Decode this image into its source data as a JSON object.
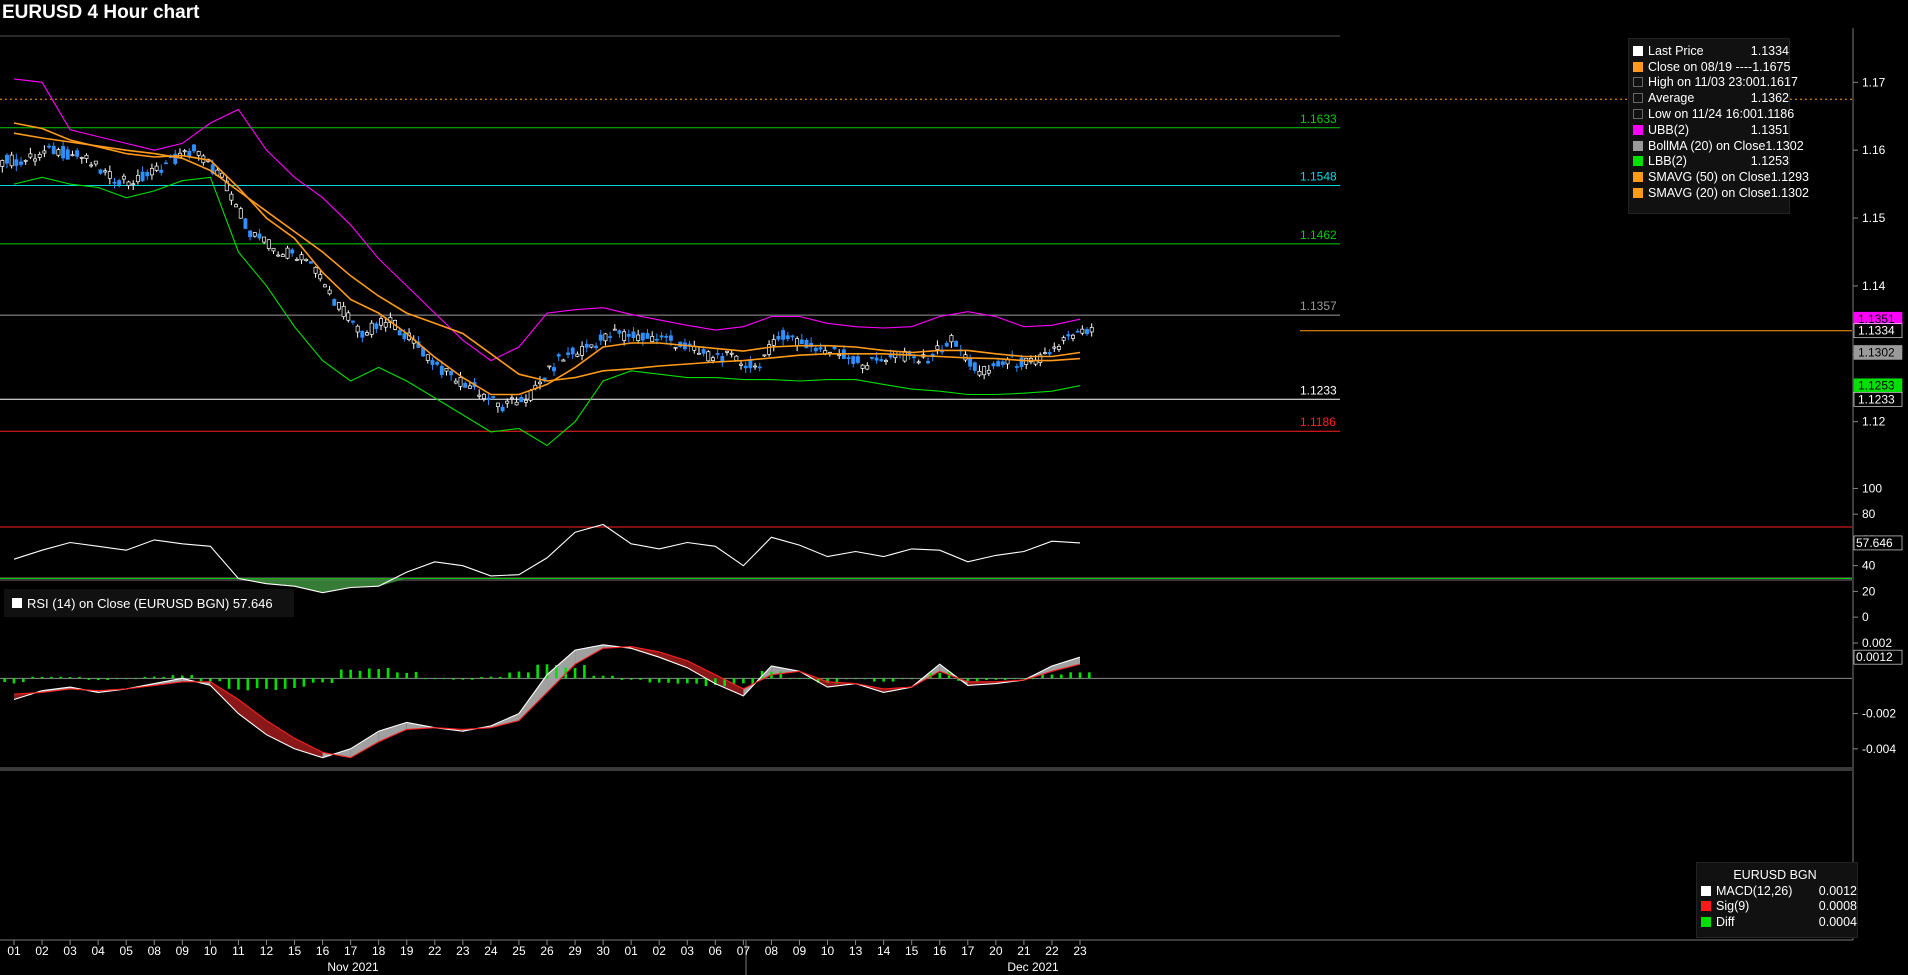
{
  "title": "EURUSD 4 Hour chart",
  "legend": [
    {
      "name": "Last Price",
      "value": "1.1334",
      "color": "#ffffff"
    },
    {
      "name": "Close on 08/19 ----",
      "value": "1.1675",
      "color": "#ff9a1a"
    },
    {
      "name": "High on 11/03 23:00",
      "value": "1.1617",
      "color": ""
    },
    {
      "name": "Average",
      "value": "1.1362",
      "color": ""
    },
    {
      "name": "Low on 11/24 16:00",
      "value": "1.1186",
      "color": ""
    },
    {
      "name": "UBB(2)",
      "value": "1.1351",
      "color": "#ff00ff"
    },
    {
      "name": "BollMA (20)  on Close",
      "value": "1.1302",
      "color": "#9a9a9a"
    },
    {
      "name": "LBB(2)",
      "value": "1.1253",
      "color": "#00e000"
    },
    {
      "name": "SMAVG (50)  on Close",
      "value": "1.1293",
      "color": "#ff9a1a"
    },
    {
      "name": "SMAVG (20)  on Close",
      "value": "1.1302",
      "color": "#ff9a1a"
    }
  ],
  "rsi_legend": "RSI (14)  on Close (EURUSD BGN) 57.646",
  "macd_legend": {
    "title": "EURUSD BGN",
    "rows": [
      {
        "name": "MACD(12,26)",
        "value": "0.0012",
        "color": "#ffffff"
      },
      {
        "name": "Sig(9)",
        "value": "0.0008",
        "color": "#ff1a1a"
      },
      {
        "name": "Diff",
        "value": "0.0004",
        "color": "#00e000"
      }
    ]
  },
  "chart_data": [
    {
      "type": "candlestick",
      "title": "EURUSD 4 Hour chart",
      "ylim": [
        1.112,
        1.178
      ],
      "y_ticks": [
        1.12,
        1.13,
        1.14,
        1.15,
        1.16,
        1.17
      ],
      "x_ticks": [
        "01",
        "02",
        "03",
        "04",
        "05",
        "08",
        "09",
        "10",
        "11",
        "12",
        "15",
        "16",
        "17",
        "18",
        "19",
        "22",
        "23",
        "24",
        "25",
        "26",
        "29",
        "30",
        "01",
        "02",
        "03",
        "06",
        "07",
        "08",
        "09",
        "10",
        "13",
        "14",
        "15",
        "16",
        "17",
        "20",
        "21",
        "22",
        "23"
      ],
      "x_groups": [
        {
          "label": "Nov 2021",
          "start": 0
        },
        {
          "label": "Dec 2021",
          "start": 22
        }
      ],
      "levels": [
        {
          "value": 1.1675,
          "label": "",
          "color": "#ff9a1a",
          "dotted": true
        },
        {
          "value": 1.1633,
          "label": "1.1633",
          "color": "#00cc00"
        },
        {
          "value": 1.1548,
          "label": "1.1548",
          "color": "#00d8e0"
        },
        {
          "value": 1.1462,
          "label": "1.1462",
          "color": "#00cc00"
        },
        {
          "value": 1.1357,
          "label": "1.1357",
          "color": "#9a9a9a"
        },
        {
          "value": 1.1233,
          "label": "1.1233",
          "color": "#ffffff"
        },
        {
          "value": 1.1186,
          "label": "1.1186",
          "color": "#ff2020"
        }
      ],
      "close_by_day": [
        1.1585,
        1.16,
        1.159,
        1.156,
        1.1555,
        1.158,
        1.16,
        1.156,
        1.148,
        1.145,
        1.1445,
        1.138,
        1.133,
        1.135,
        1.131,
        1.127,
        1.125,
        1.122,
        1.124,
        1.129,
        1.131,
        1.133,
        1.1325,
        1.132,
        1.13,
        1.1295,
        1.128,
        1.133,
        1.131,
        1.13,
        1.1285,
        1.13,
        1.129,
        1.132,
        1.127,
        1.129,
        1.1285,
        1.132,
        1.1334
      ],
      "series": [
        {
          "name": "UBB(2)",
          "color": "#ff00ff",
          "values": [
            1.1705,
            1.17,
            1.163,
            1.162,
            1.161,
            1.16,
            1.161,
            1.164,
            1.166,
            1.16,
            1.156,
            1.153,
            1.149,
            1.144,
            1.14,
            1.136,
            1.132,
            1.129,
            1.131,
            1.136,
            1.1365,
            1.1368,
            1.1358,
            1.135,
            1.1342,
            1.1335,
            1.134,
            1.1355,
            1.1355,
            1.1345,
            1.134,
            1.1338,
            1.134,
            1.1355,
            1.1362,
            1.1355,
            1.134,
            1.1342,
            1.1351
          ]
        },
        {
          "name": "LBB(2)",
          "color": "#00e000",
          "values": [
            1.155,
            1.156,
            1.155,
            1.1545,
            1.153,
            1.154,
            1.1555,
            1.156,
            1.145,
            1.14,
            1.134,
            1.129,
            1.126,
            1.128,
            1.126,
            1.1235,
            1.121,
            1.1185,
            1.119,
            1.1165,
            1.12,
            1.126,
            1.1275,
            1.127,
            1.1265,
            1.1265,
            1.1262,
            1.1262,
            1.126,
            1.1262,
            1.1262,
            1.1255,
            1.1248,
            1.1245,
            1.124,
            1.124,
            1.1242,
            1.1245,
            1.1253
          ]
        },
        {
          "name": "SMAVG (20)  on Close",
          "color": "#ff9a1a",
          "values": [
            1.164,
            1.1632,
            1.1615,
            1.1605,
            1.1595,
            1.159,
            1.1592,
            1.1585,
            1.1545,
            1.15,
            1.147,
            1.142,
            1.138,
            1.136,
            1.133,
            1.1295,
            1.1265,
            1.124,
            1.124,
            1.1255,
            1.128,
            1.131,
            1.1316,
            1.1316,
            1.1312,
            1.1308,
            1.1304,
            1.131,
            1.1312,
            1.1312,
            1.131,
            1.1305,
            1.1302,
            1.1305,
            1.1305,
            1.13,
            1.1296,
            1.1296,
            1.1302
          ]
        },
        {
          "name": "SMAVG (50)  on Close",
          "color": "#ff9a1a",
          "values": [
            1.1625,
            1.1618,
            1.1612,
            1.1606,
            1.16,
            1.1595,
            1.1588,
            1.157,
            1.154,
            1.151,
            1.148,
            1.145,
            1.1415,
            1.1385,
            1.136,
            1.1345,
            1.133,
            1.13,
            1.127,
            1.126,
            1.1265,
            1.1275,
            1.1278,
            1.1282,
            1.1285,
            1.1288,
            1.129,
            1.1294,
            1.1298,
            1.13,
            1.13,
            1.13,
            1.1298,
            1.1296,
            1.1294,
            1.1293,
            1.129,
            1.129,
            1.1293
          ]
        }
      ],
      "axis_tags": [
        {
          "value": 1.1351,
          "label": "1.1351",
          "bg": "#ff00ff",
          "fg": "#000000"
        },
        {
          "value": 1.1334,
          "label": "1.1334",
          "bg": "#000000",
          "fg": "#ffffff"
        },
        {
          "value": 1.1302,
          "label": "1.1302",
          "bg": "#9a9a9a",
          "fg": "#000000"
        },
        {
          "value": 1.1253,
          "label": "1.1253",
          "bg": "#00e000",
          "fg": "#000000"
        },
        {
          "value": 1.1233,
          "label": "1.1233",
          "bg": "#000000",
          "fg": "#ffffff"
        }
      ]
    },
    {
      "type": "line",
      "name": "RSI (14)  on Close (EURUSD BGN)",
      "ylim": [
        -10,
        105
      ],
      "y_ticks": [
        0,
        20,
        40,
        60,
        80,
        100
      ],
      "overbought": 70,
      "oversold": 30,
      "last_value": "57.646",
      "values": [
        45,
        52,
        58,
        55,
        52,
        60,
        57,
        55,
        30,
        26,
        24,
        19,
        23,
        24,
        35,
        43,
        40,
        32,
        33,
        46,
        66,
        72,
        57,
        53,
        58,
        55,
        40,
        62,
        56,
        47,
        51,
        47,
        53,
        52,
        43,
        48,
        51,
        59,
        57.646
      ]
    },
    {
      "type": "area",
      "name": "MACD",
      "ylim": [
        -0.0052,
        0.0024
      ],
      "y_ticks": [
        -0.004,
        -0.002,
        0.002
      ],
      "last_value": "0.0012",
      "macd": [
        -0.0012,
        -0.0007,
        -0.0005,
        -0.0008,
        -0.0006,
        -0.0003,
        0.0,
        -0.0004,
        -0.002,
        -0.0032,
        -0.004,
        -0.0045,
        -0.004,
        -0.003,
        -0.0025,
        -0.0028,
        -0.003,
        -0.0027,
        -0.002,
        0.0002,
        0.0016,
        0.0019,
        0.0017,
        0.0012,
        0.0006,
        -0.0003,
        -0.001,
        0.0007,
        0.0004,
        -0.0005,
        -0.0003,
        -0.0008,
        -0.0005,
        0.0008,
        -0.0004,
        -0.0003,
        -0.0001,
        0.0007,
        0.0012
      ],
      "signal": [
        -0.0009,
        -0.0008,
        -0.0006,
        -0.0007,
        -0.0006,
        -0.0004,
        -0.0002,
        -0.0002,
        -0.0012,
        -0.0024,
        -0.0034,
        -0.0042,
        -0.0045,
        -0.0036,
        -0.0029,
        -0.0028,
        -0.0029,
        -0.0028,
        -0.0024,
        -0.0008,
        0.0008,
        0.0017,
        0.0018,
        0.0015,
        0.001,
        0.0002,
        -0.0006,
        0.0002,
        0.0004,
        -0.0002,
        -0.0003,
        -0.0006,
        -0.0005,
        0.0004,
        -0.0002,
        -0.0002,
        -0.0001,
        0.0004,
        0.0008
      ]
    }
  ]
}
